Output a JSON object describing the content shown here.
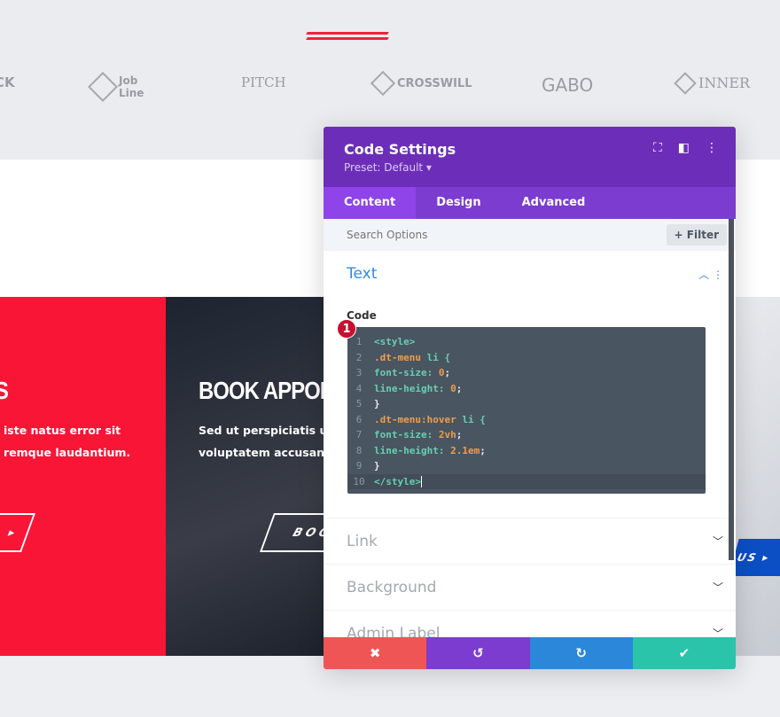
{
  "logos": [
    "CK",
    "Job Line",
    "PITCH",
    "CROSSWILL",
    "GABO",
    "INNER"
  ],
  "cards": {
    "red": {
      "heading": "S",
      "text": [
        "iste natus error sit",
        "remque laudantium."
      ],
      "button": "▸"
    },
    "dark": {
      "heading": "BOOK APPOI",
      "text": [
        "Sed ut perspiciatis unde",
        "voluptatem accusantiu"
      ],
      "button": "BOO"
    },
    "right": {
      "button": "US ▸"
    }
  },
  "modal": {
    "title": "Code Settings",
    "preset": "Preset: Default ▾",
    "tabs": [
      "Content",
      "Design",
      "Advanced"
    ],
    "search_placeholder": "Search Options",
    "filter": "+ Filter",
    "section_text": "Text",
    "code_label": "Code",
    "badge": "1",
    "code": [
      [
        [
          "<style>",
          "g"
        ]
      ],
      [
        [
          ".dt-menu",
          "o"
        ],
        [
          " li {",
          "g"
        ]
      ],
      [
        [
          "font-size:",
          "g"
        ],
        [
          " 0",
          "o"
        ],
        [
          ";",
          "w"
        ]
      ],
      [
        [
          "line-height:",
          "g"
        ],
        [
          " 0",
          "o"
        ],
        [
          ";",
          "w"
        ]
      ],
      [
        [
          "}",
          "w"
        ]
      ],
      [
        [
          ".dt-menu",
          "o"
        ],
        [
          ":hover",
          "o"
        ],
        [
          " li {",
          "g"
        ]
      ],
      [
        [
          "font-size:",
          "g"
        ],
        [
          " 2vh",
          "o"
        ],
        [
          ";",
          "w"
        ]
      ],
      [
        [
          "line-height:",
          "g"
        ],
        [
          " 2.1em",
          "o"
        ],
        [
          ";",
          "w"
        ]
      ],
      [
        [
          "}",
          "w"
        ]
      ],
      [
        [
          "</style>",
          "g"
        ]
      ]
    ],
    "sections": [
      "Link",
      "Background",
      "Admin Label"
    ],
    "footer": {
      "cancel": "✖",
      "undo": "↺",
      "redo": "↻",
      "save": "✔"
    }
  },
  "colors": {
    "purple": "#6c2eb9",
    "cancel": "#ef5555",
    "undo": "#7b3ccf",
    "redo": "#2b87da",
    "save": "#29c4a9",
    "red_card": "#f81536"
  }
}
